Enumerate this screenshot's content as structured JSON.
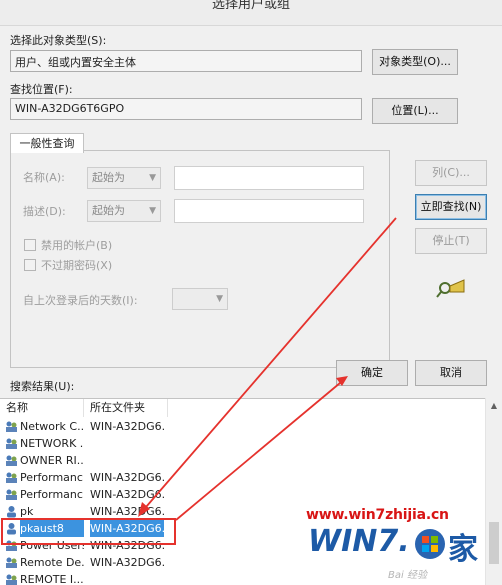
{
  "window": {
    "title": "选择用户或组"
  },
  "object_type": {
    "label": "选择此对象类型(S):",
    "value": "用户、组或内置安全主体",
    "button": "对象类型(O)..."
  },
  "location": {
    "label": "查找位置(F):",
    "value": "WIN-A32DG6T6GPO",
    "button": "位置(L)..."
  },
  "query": {
    "tab": "一般性查询",
    "name_label": "名称(A):",
    "name_mode": "起始为",
    "desc_label": "描述(D):",
    "desc_mode": "起始为",
    "disabled_accounts": "禁用的帐户(B)",
    "non_expiring": "不过期密码(X)",
    "days_since_logon": "自上次登录后的天数(I):"
  },
  "side_buttons": {
    "columns": "列(C)...",
    "find_now": "立即查找(N)",
    "stop": "停止(T)"
  },
  "dialog_buttons": {
    "ok": "确定",
    "cancel": "取消"
  },
  "results": {
    "label": "搜索结果(U):",
    "columns": [
      "名称",
      "所在文件夹"
    ],
    "rows": [
      {
        "name": "Network C...",
        "folder": "WIN-A32DG6..."
      },
      {
        "name": "NETWORK ...",
        "folder": ""
      },
      {
        "name": "OWNER RI...",
        "folder": ""
      },
      {
        "name": "Performanc...",
        "folder": "WIN-A32DG6..."
      },
      {
        "name": "Performanc...",
        "folder": "WIN-A32DG6..."
      },
      {
        "name": "pk",
        "folder": "WIN-A32DG6..."
      },
      {
        "name": "pkaust8",
        "folder": "WIN-A32DG6..."
      },
      {
        "name": "Power Users",
        "folder": "WIN-A32DG6..."
      },
      {
        "name": "Remote De...",
        "folder": "WIN-A32DG6..."
      },
      {
        "name": "REMOTE I...",
        "folder": ""
      }
    ]
  },
  "watermark": {
    "text": "www.win7zhijia.cn",
    "logo_text": "WIN7.",
    "logo_suffix": "家",
    "baidu": "Bai  经验"
  },
  "colors": {
    "annotation_red": "#e5322d",
    "selection_blue": "#3c93df"
  }
}
